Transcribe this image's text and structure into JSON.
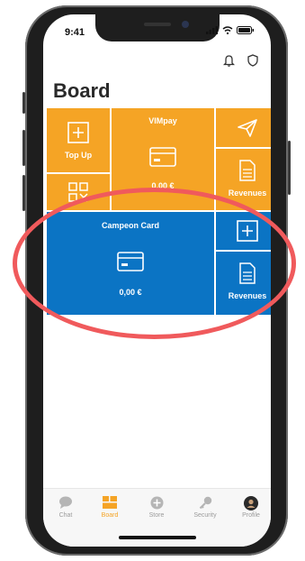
{
  "status_bar": {
    "time": "9:41"
  },
  "page": {
    "title": "Board"
  },
  "tiles": {
    "top_up": "Top Up",
    "vimpay": "VIMpay",
    "vimpay_amount": "0,00 €",
    "revenues_top": "Revenues",
    "campeon_card": "Campeon Card",
    "campeon_amount": "0,00 €",
    "revenues_bottom": "Revenues"
  },
  "tabs": [
    {
      "label": "Chat",
      "icon": "chat-icon"
    },
    {
      "label": "Board",
      "icon": "board-icon"
    },
    {
      "label": "Store",
      "icon": "store-icon"
    },
    {
      "label": "Security",
      "icon": "key-icon"
    },
    {
      "label": "Profile",
      "icon": "avatar-icon"
    }
  ],
  "colors": {
    "orange": "#f5a425",
    "blue": "#0b74c4",
    "annotation": "#f05a5c"
  }
}
